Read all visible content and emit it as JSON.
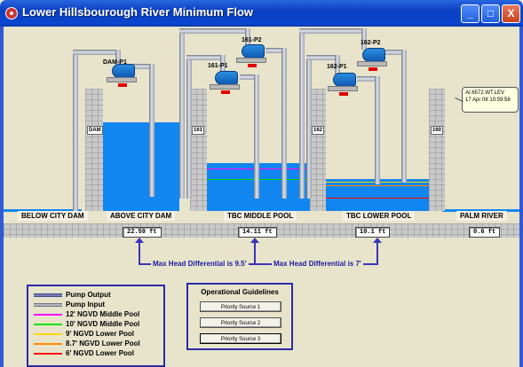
{
  "window": {
    "title": "Lower Hillsbourough River Minimum Flow",
    "minimize": "_",
    "maximize": "□",
    "close": "X"
  },
  "pumps": {
    "dam_p1": "DAM-P1",
    "p161_1": "161-P1",
    "p161_2": "161-P2",
    "p162_1": "162-P1",
    "p162_2": "162-P2"
  },
  "gates": {
    "dam": "DAM",
    "g161": "161",
    "g162": "162",
    "g160": "160"
  },
  "pools": {
    "below_city_dam": "BELOW CITY DAM",
    "above_city_dam": "ABOVE CITY DAM",
    "tbc_middle_pool": "TBC MIDDLE POOL",
    "tbc_lower_pool": "TBC LOWER POOL",
    "palm_river": "PALM RIVER"
  },
  "readings": {
    "above_city_dam": "22.59 ft",
    "tbc_middle_pool": "14.11 ft",
    "tbc_lower_pool": "10.1 ft",
    "palm_river": "0.6 ft"
  },
  "head_differential": {
    "upper": "Max Head Differential is 9.5'",
    "lower": "Max Head Differential is 7'"
  },
  "tooltip": {
    "tag": "AI.6572.WT.LEV",
    "timestamp": "17 Apr 08 10:59:58"
  },
  "legend": {
    "items": [
      {
        "label": "Pump Output",
        "color": "#4a4f9a"
      },
      {
        "label": "Pump Input",
        "color": "#7c8090"
      },
      {
        "label": "12' NGVD Middle Pool",
        "color": "#ff00ff"
      },
      {
        "label": "10' NGVD Middle Pool",
        "color": "#00e000"
      },
      {
        "label": "9' NGVD Lower Pool",
        "color": "#ffd700"
      },
      {
        "label": "8.7' NGVD Lower Pool",
        "color": "#ff8c00"
      },
      {
        "label": "6' NGVD Lower Pool",
        "color": "#ff0000"
      }
    ]
  },
  "guidelines": {
    "title": "Operational Guidelines",
    "buttons": [
      "Priority Source 1",
      "Priority Source 2",
      "Priority Source 3"
    ]
  }
}
